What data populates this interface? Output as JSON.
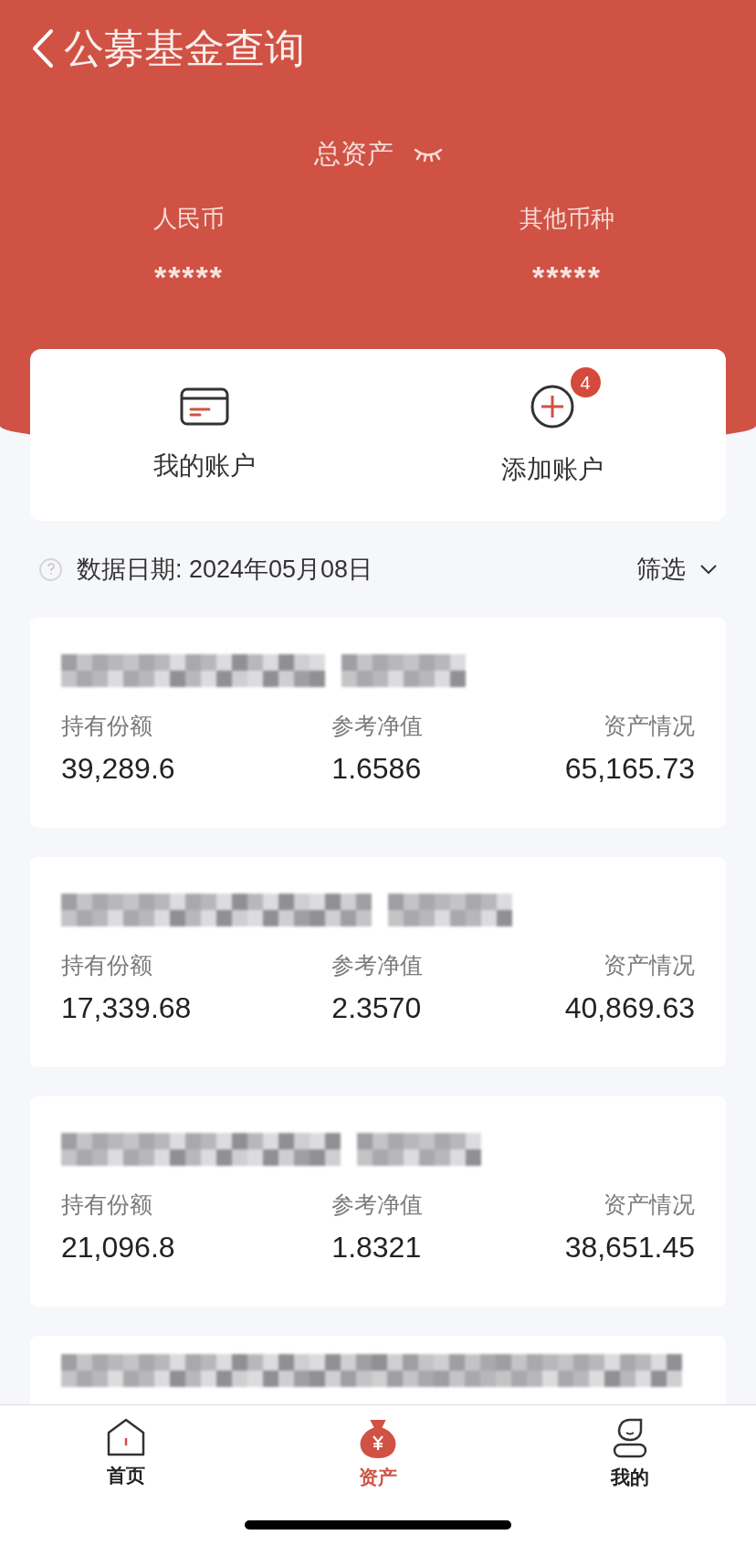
{
  "header": {
    "title": "公募基金查询",
    "total_label": "总资产",
    "masked": true,
    "currencies": [
      {
        "label": "人民币",
        "value": "*****"
      },
      {
        "label": "其他币种",
        "value": "*****"
      }
    ]
  },
  "actions": [
    {
      "label": "我的账户",
      "kind": "card"
    },
    {
      "label": "添加账户",
      "kind": "add",
      "badge": "4"
    }
  ],
  "data_date": "数据日期: 2024年05月08日",
  "filter": "筛选",
  "funds": [
    {
      "kind": "full",
      "columns": [
        {
          "label": "持有份额",
          "value": "39,289.6"
        },
        {
          "label": "参考净值",
          "value": "1.6586"
        },
        {
          "label": "资产情况",
          "value": "65,165.73"
        }
      ]
    },
    {
      "kind": "full",
      "columns": [
        {
          "label": "持有份额",
          "value": "17,339.68"
        },
        {
          "label": "参考净值",
          "value": "2.3570"
        },
        {
          "label": "资产情况",
          "value": "40,869.63"
        }
      ]
    },
    {
      "kind": "full",
      "columns": [
        {
          "label": "持有份额",
          "value": "21,096.8"
        },
        {
          "label": "参考净值",
          "value": "1.8321"
        },
        {
          "label": "资产情况",
          "value": "38,651.45"
        }
      ]
    },
    {
      "kind": "cut"
    }
  ],
  "tabs": [
    {
      "label": "首页",
      "kind": "home",
      "selected": false
    },
    {
      "label": "资产",
      "kind": "assets",
      "selected": true
    },
    {
      "label": "我的",
      "kind": "me",
      "selected": false
    }
  ]
}
